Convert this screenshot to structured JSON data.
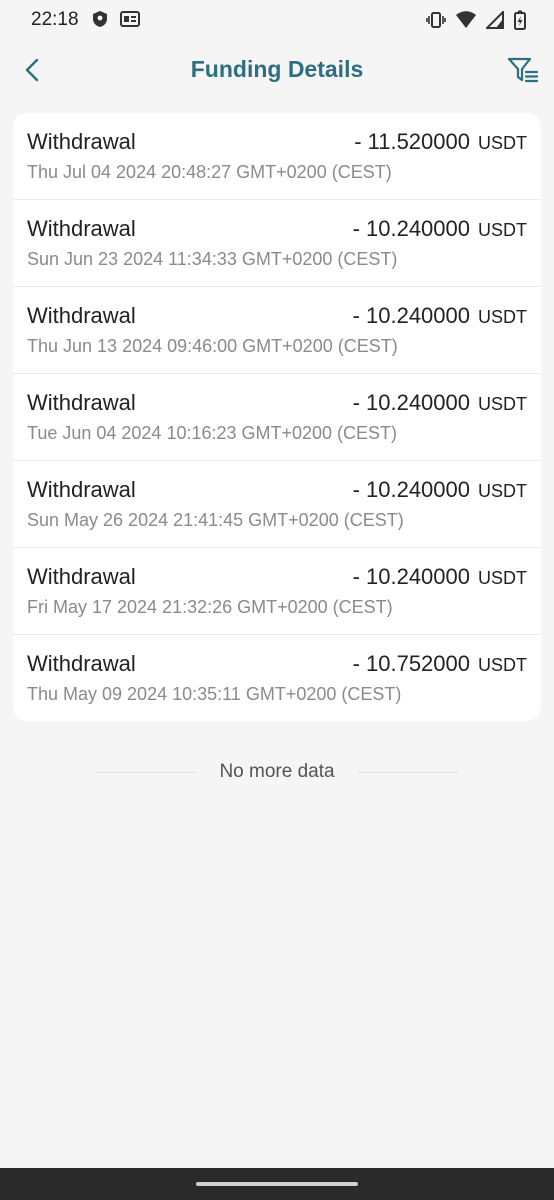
{
  "status_bar": {
    "time": "22:18",
    "left_icons": [
      "shield-icon",
      "g-badge-icon"
    ],
    "right_icons": [
      "vibrate-icon",
      "wifi-icon",
      "signal-icon",
      "battery-charging-icon"
    ]
  },
  "header": {
    "title": "Funding Details",
    "back_icon": "chevron-left-icon",
    "filter_icon": "filter-list-icon"
  },
  "transactions": [
    {
      "type": "Withdrawal",
      "amount": "- 11.520000",
      "currency": "USDT",
      "date": "Thu Jul 04 2024 20:48:27 GMT+0200 (CEST)"
    },
    {
      "type": "Withdrawal",
      "amount": "- 10.240000",
      "currency": "USDT",
      "date": "Sun Jun 23 2024 11:34:33 GMT+0200 (CEST)"
    },
    {
      "type": "Withdrawal",
      "amount": "- 10.240000",
      "currency": "USDT",
      "date": "Thu Jun 13 2024 09:46:00 GMT+0200 (CEST)"
    },
    {
      "type": "Withdrawal",
      "amount": "- 10.240000",
      "currency": "USDT",
      "date": "Tue Jun 04 2024 10:16:23 GMT+0200 (CEST)"
    },
    {
      "type": "Withdrawal",
      "amount": "- 10.240000",
      "currency": "USDT",
      "date": "Sun May 26 2024 21:41:45 GMT+0200 (CEST)"
    },
    {
      "type": "Withdrawal",
      "amount": "- 10.240000",
      "currency": "USDT",
      "date": "Fri May 17 2024 21:32:26 GMT+0200 (CEST)"
    },
    {
      "type": "Withdrawal",
      "amount": "- 10.752000",
      "currency": "USDT",
      "date": "Thu May 09 2024 10:35:11 GMT+0200 (CEST)"
    }
  ],
  "end_of_list": "No more data",
  "colors": {
    "accent": "#2d6e80",
    "background": "#f5f5f5",
    "card": "#ffffff",
    "secondary_text": "#8a8a8a"
  }
}
